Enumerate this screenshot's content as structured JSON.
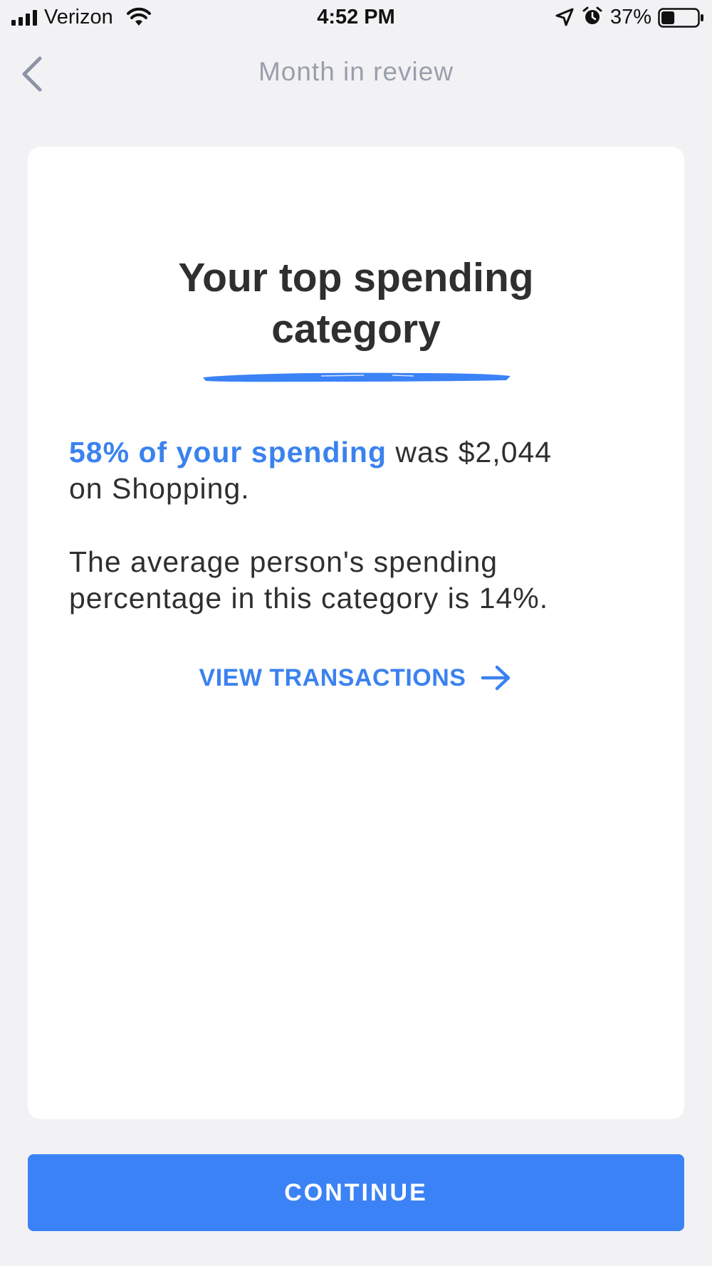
{
  "status_bar": {
    "carrier": "Verizon",
    "time": "4:52 PM",
    "battery_percent": "37%",
    "battery_level": 0.37,
    "icons": [
      "signal-icon",
      "wifi-icon",
      "location-icon",
      "alarm-icon",
      "battery-icon"
    ]
  },
  "nav": {
    "back_icon": "chevron-left-icon",
    "title": "Month in review"
  },
  "card": {
    "heading_line1": "Your top spending",
    "heading_line2": "category",
    "stat_highlight": "58% of your spending",
    "stat_rest_line1": " was $2,044",
    "stat_rest_line2": "on Shopping.",
    "average_line1": "The average person's spending",
    "average_line2": "percentage in this category is 14%.",
    "view_transactions_label": "VIEW TRANSACTIONS",
    "view_transactions_icon": "arrow-right-icon"
  },
  "continue_button": {
    "label": "CONTINUE"
  },
  "colors": {
    "accent": "#3b82f6",
    "background": "#f2f2f5",
    "card": "#ffffff",
    "heading_text": "#2f2f2f",
    "nav_title": "#9a9fac"
  }
}
